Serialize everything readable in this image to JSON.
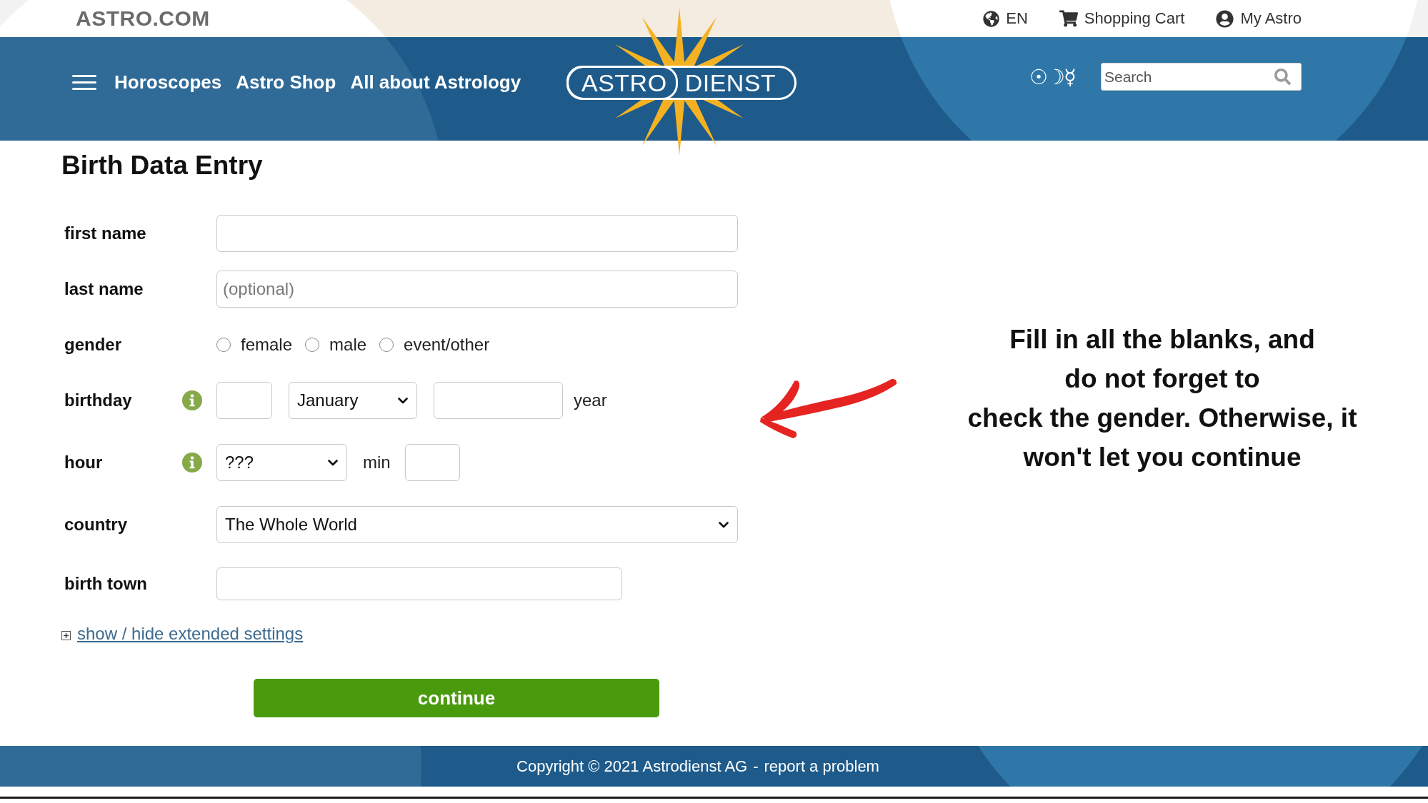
{
  "top_bar": {
    "site_name": "ASTRO.COM",
    "links": [
      {
        "kind": "language",
        "label": "EN"
      },
      {
        "kind": "cart",
        "label": "Shopping Cart"
      },
      {
        "kind": "account",
        "label": "My Astro"
      }
    ]
  },
  "nav_bar": {
    "menu_items": [
      "Horoscopes",
      "Astro Shop",
      "All about Astrology"
    ],
    "logo": [
      "ASTRO",
      "DIENST"
    ],
    "symbols": "☉☽☿",
    "search": {
      "placeholder": "Search"
    }
  },
  "page_title": "Birth Data Entry",
  "form": {
    "fields": [
      {
        "kind": "text",
        "label": "first name"
      },
      {
        "kind": "text",
        "label": "last name",
        "placeholder": "(optional)"
      },
      {
        "kind": "radio",
        "label": "gender",
        "options": [
          {
            "label": "female",
            "selected": false
          },
          {
            "label": "male",
            "selected": false
          },
          {
            "label": "event/other",
            "selected": false
          }
        ]
      },
      {
        "kind": "date",
        "label": "birthday",
        "info": true,
        "month": "January",
        "suffix": "year"
      },
      {
        "kind": "time",
        "label": "hour",
        "info": true,
        "hour": "???",
        "unit": "min"
      },
      {
        "kind": "select",
        "label": "country",
        "value": "The Whole World"
      },
      {
        "kind": "short_text",
        "label": "birth town"
      }
    ],
    "extended_settings": {
      "label": "show / hide extended settings",
      "expanded": false
    },
    "submit": "continue"
  },
  "annotation": {
    "lines": [
      "Fill in all the blanks, and",
      "do not forget to",
      "check the gender. Otherwise, it",
      "won't let you continue"
    ]
  },
  "footer": {
    "copyright": "Copyright © 2021 Astrodienst AG",
    "separator": "-",
    "link": "report a problem"
  }
}
